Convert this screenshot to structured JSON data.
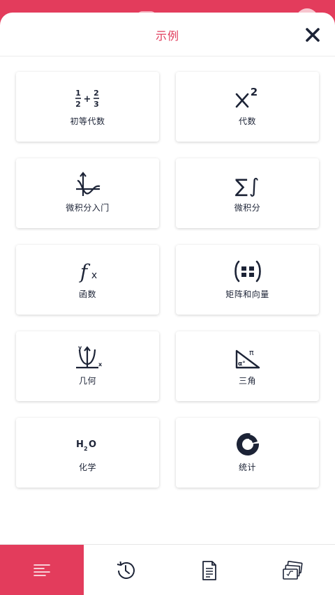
{
  "header": {
    "title": "示例"
  },
  "categories": [
    {
      "label": "初等代数",
      "icon": "fraction-icon"
    },
    {
      "label": "代数",
      "icon": "x-squared-icon"
    },
    {
      "label": "微积分入门",
      "icon": "precalc-graph-icon"
    },
    {
      "label": "微积分",
      "icon": "sum-integral-icon"
    },
    {
      "label": "函数",
      "icon": "function-icon"
    },
    {
      "label": "矩阵和向量",
      "icon": "matrix-icon"
    },
    {
      "label": "几何",
      "icon": "parabola-axes-icon"
    },
    {
      "label": "三角",
      "icon": "triangle-angle-icon"
    },
    {
      "label": "化学",
      "icon": "h2o-icon"
    },
    {
      "label": "统计",
      "icon": "donut-chart-icon"
    }
  ],
  "glyphs": {
    "frac_num1": "1",
    "frac_den1": "2",
    "frac_plus": "+",
    "frac_num2": "2",
    "frac_den2": "3",
    "x": "x",
    "sup2": "2",
    "sum": "∑",
    "integral": "∫",
    "f": "f",
    "fx": "x",
    "geo_y": "y",
    "geo_x": "x",
    "pi": "π",
    "alpha": "α°",
    "h": "H",
    "h_sub": "2",
    "o": "O"
  },
  "bottom_nav": [
    {
      "name": "examples",
      "icon": "list-icon",
      "active": true
    },
    {
      "name": "history",
      "icon": "history-icon",
      "active": false
    },
    {
      "name": "notes",
      "icon": "document-icon",
      "active": false
    },
    {
      "name": "cards",
      "icon": "flashcards-icon",
      "active": false
    }
  ],
  "colors": {
    "accent": "#e33c5c",
    "ink": "#1c2336"
  }
}
